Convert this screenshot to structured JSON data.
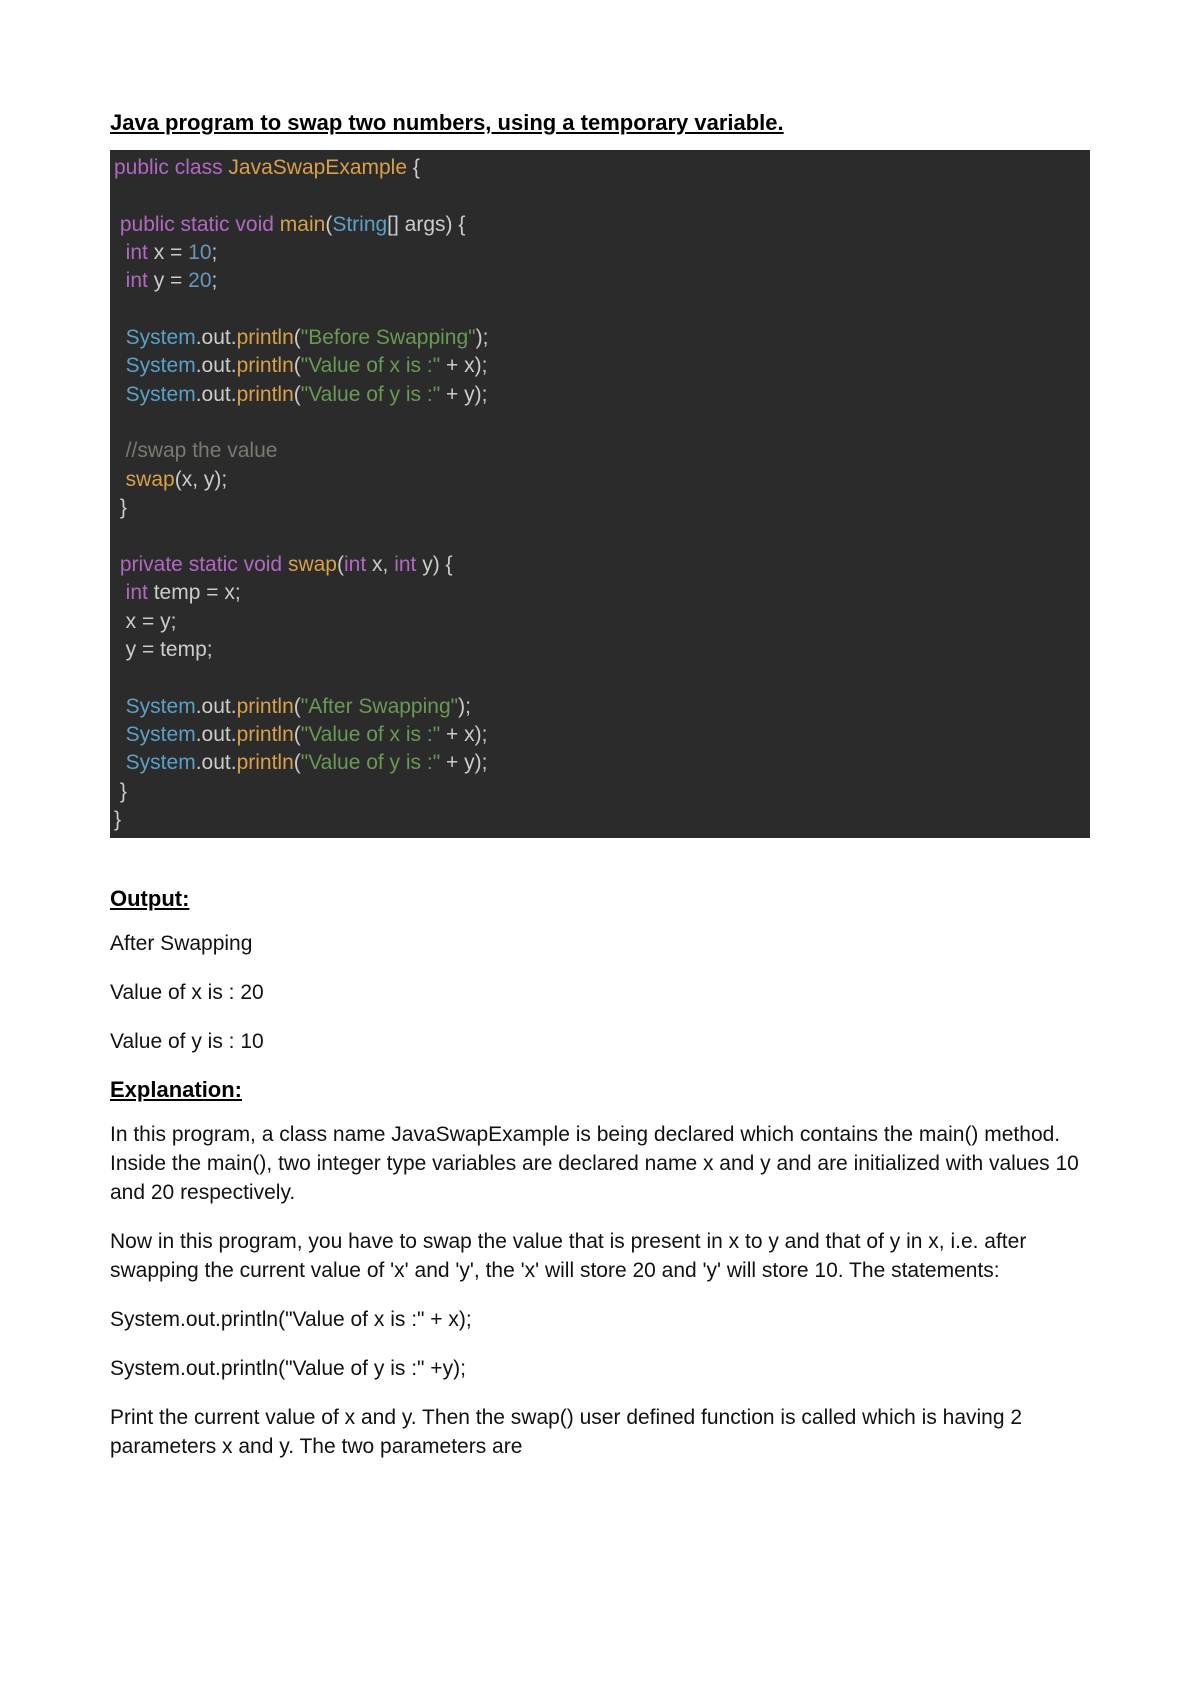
{
  "title": " Java program to swap two numbers, using a temporary variable.",
  "code": {
    "l1a": "public",
    "l1b": "class",
    "l1c": "JavaSwapExample",
    "l1d": " {",
    "l2_blank": "",
    "l3a": " public",
    "l3b": "static",
    "l3c": "void",
    "l3d": "main",
    "l3e": "(",
    "l3f": "String",
    "l3g": "[] args) {",
    "l4a": "  int",
    "l4b": " x = ",
    "l4c": "10",
    "l4d": ";",
    "l5a": "  int",
    "l5b": " y = ",
    "l5c": "20",
    "l5d": ";",
    "l6_blank": "",
    "l7a": "  System",
    "l7b": ".out.",
    "l7c": "println",
    "l7d": "(",
    "l7e": "\"Before Swapping\"",
    "l7f": ");",
    "l8a": "  System",
    "l8b": ".out.",
    "l8c": "println",
    "l8d": "(",
    "l8e": "\"Value of x is :\"",
    "l8f": " + x);",
    "l9a": "  System",
    "l9b": ".out.",
    "l9c": "println",
    "l9d": "(",
    "l9e": "\"Value of y is :\"",
    "l9f": " + y);",
    "l10_blank": "",
    "l11a": "  //swap the value",
    "l12a": "  swap",
    "l12b": "(x, y);",
    "l13a": " }",
    "l14_blank": "",
    "l15a": " private",
    "l15b": "static",
    "l15c": "void",
    "l15d": "swap",
    "l15e": "(",
    "l15f": "int",
    "l15g": " x, ",
    "l15h": "int",
    "l15i": " y) {",
    "l16a": "  int",
    "l16b": " temp = x;",
    "l17a": "  x = y;",
    "l18a": "  y = temp;",
    "l19_blank": "",
    "l20a": "  System",
    "l20b": ".out.",
    "l20c": "println",
    "l20d": "(",
    "l20e": "\"After Swapping\"",
    "l20f": ");",
    "l21a": "  System",
    "l21b": ".out.",
    "l21c": "println",
    "l21d": "(",
    "l21e": "\"Value of x is :\"",
    "l21f": " + x);",
    "l22a": "  System",
    "l22b": ".out.",
    "l22c": "println",
    "l22d": "(",
    "l22e": "\"Value of y is :\"",
    "l22f": " + y);",
    "l23a": " }",
    "l24a": "}"
  },
  "output": {
    "heading": "Output:",
    "lines": [
      "After Swapping",
      "Value of x is : 20",
      "Value of y is : 10"
    ]
  },
  "explanation": {
    "heading": "Explanation:",
    "p1": "In this program, a class name JavaSwapExample is being declared which contains the main() method. Inside the main(), two integer type variables are declared name x and y and are initialized with values 10 and 20 respectively.",
    "p2": "Now in this program, you have to swap the value that is present in x to y and that of y in x, i.e. after swapping the current value of 'x' and 'y', the 'x' will store 20 and 'y' will store 10. The statements:",
    "p3": "System.out.println(\"Value of x is :\" + x);",
    "p4": "System.out.println(\"Value of y is :\" +y);",
    "p5": "Print the current value of x and y. Then the swap() user defined function is called which is having 2 parameters x and y. The two parameters are"
  }
}
